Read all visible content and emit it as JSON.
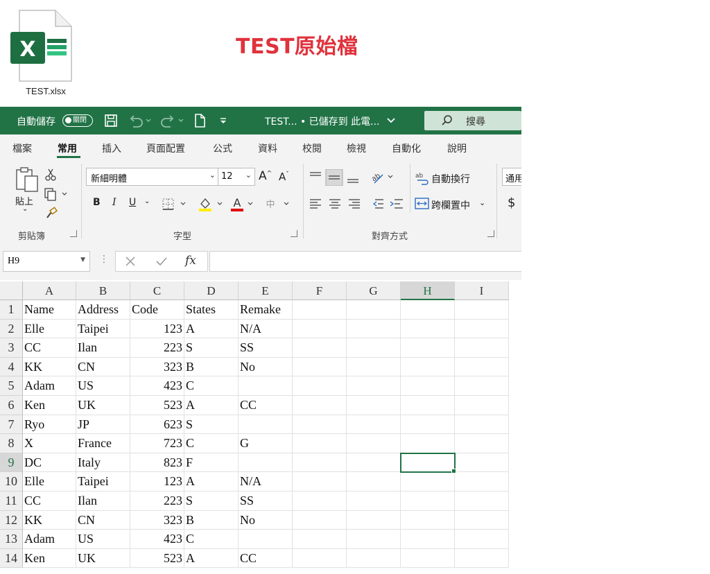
{
  "file": {
    "name": "TEST.xlsx",
    "icon_letter": "X"
  },
  "heading": "TEST原始檔",
  "titlebar": {
    "autosave_label": "自動儲存",
    "autosave_state": "關閉",
    "doc_title": "TEST... • 已儲存到 此電...",
    "search_label": "搜尋"
  },
  "tabs": [
    "檔案",
    "常用",
    "插入",
    "頁面配置",
    "公式",
    "資料",
    "校閱",
    "檢視",
    "自動化",
    "說明"
  ],
  "active_tab": "常用",
  "ribbon": {
    "paste_label": "貼上",
    "font_name": "新細明體",
    "font_size": "12",
    "wrap_text": "自動換行",
    "merge_center": "跨欄置中",
    "number_format": "通用",
    "currency_symbol": "$",
    "bold": "B",
    "italic": "I",
    "underline": "U",
    "group_clipboard": "剪貼簿",
    "group_font": "字型",
    "group_alignment": "對齊方式"
  },
  "formula_bar": {
    "name_box": "H9",
    "fx": "fx",
    "value": ""
  },
  "columns": [
    "A",
    "B",
    "C",
    "D",
    "E",
    "F",
    "G",
    "H",
    "I"
  ],
  "selected_column": "H",
  "selected_row": 9,
  "rows": [
    {
      "n": "1",
      "a": "Name",
      "b": "Address",
      "c": "Code",
      "d": "States",
      "e": "Remake"
    },
    {
      "n": "2",
      "a": "Elle",
      "b": "Taipei",
      "c": "123",
      "d": "A",
      "e": "N/A"
    },
    {
      "n": "3",
      "a": "CC",
      "b": "Ilan",
      "c": "223",
      "d": "S",
      "e": "SS"
    },
    {
      "n": "4",
      "a": "KK",
      "b": "CN",
      "c": "323",
      "d": "B",
      "e": "No"
    },
    {
      "n": "5",
      "a": "Adam",
      "b": "US",
      "c": "423",
      "d": "C",
      "e": ""
    },
    {
      "n": "6",
      "a": "Ken",
      "b": "UK",
      "c": "523",
      "d": "A",
      "e": "CC"
    },
    {
      "n": "7",
      "a": "Ryo",
      "b": "JP",
      "c": "623",
      "d": "S",
      "e": ""
    },
    {
      "n": "8",
      "a": "X",
      "b": "France",
      "c": "723",
      "d": "C",
      "e": "G"
    },
    {
      "n": "9",
      "a": "DC",
      "b": "Italy",
      "c": "823",
      "d": "F",
      "e": ""
    },
    {
      "n": "10",
      "a": "Elle",
      "b": "Taipei",
      "c": "123",
      "d": "A",
      "e": "N/A"
    },
    {
      "n": "11",
      "a": "CC",
      "b": "Ilan",
      "c": "223",
      "d": "S",
      "e": "SS"
    },
    {
      "n": "12",
      "a": "KK",
      "b": "CN",
      "c": "323",
      "d": "B",
      "e": "No"
    },
    {
      "n": "13",
      "a": "Adam",
      "b": "US",
      "c": "423",
      "d": "C",
      "e": ""
    },
    {
      "n": "14",
      "a": "Ken",
      "b": "UK",
      "c": "523",
      "d": "A",
      "e": "CC"
    }
  ]
}
